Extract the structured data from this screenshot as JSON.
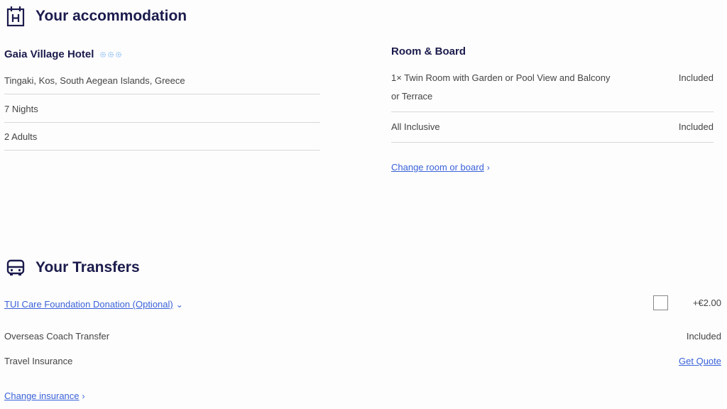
{
  "accommodation": {
    "heading": "Your accommodation",
    "hotel_name": "Gaia Village Hotel",
    "rating_stars": 3,
    "location": "Tingaki, Kos, South Aegean Islands, Greece",
    "nights": "7 Nights",
    "guests": "2  Adults"
  },
  "room_board": {
    "title": "Room & Board",
    "items": [
      {
        "description": "1× Twin Room with Garden or Pool View and Balcony or Terrace",
        "status": "Included"
      },
      {
        "description": "All Inclusive",
        "status": "Included"
      }
    ],
    "change_link": "Change room or board"
  },
  "transfers": {
    "heading": "Your Transfers",
    "donation_label": "TUI Care Foundation Donation (Optional)",
    "donation_price": "+€2.00",
    "coach_label": "Overseas Coach Transfer",
    "coach_status": "Included",
    "insurance_label": "Travel Insurance",
    "insurance_action": "Get Quote",
    "change_insurance": "Change insurance"
  },
  "colors": {
    "heading": "#1b1b4d",
    "link": "#3a62d9",
    "star": "#9ec9f5"
  }
}
